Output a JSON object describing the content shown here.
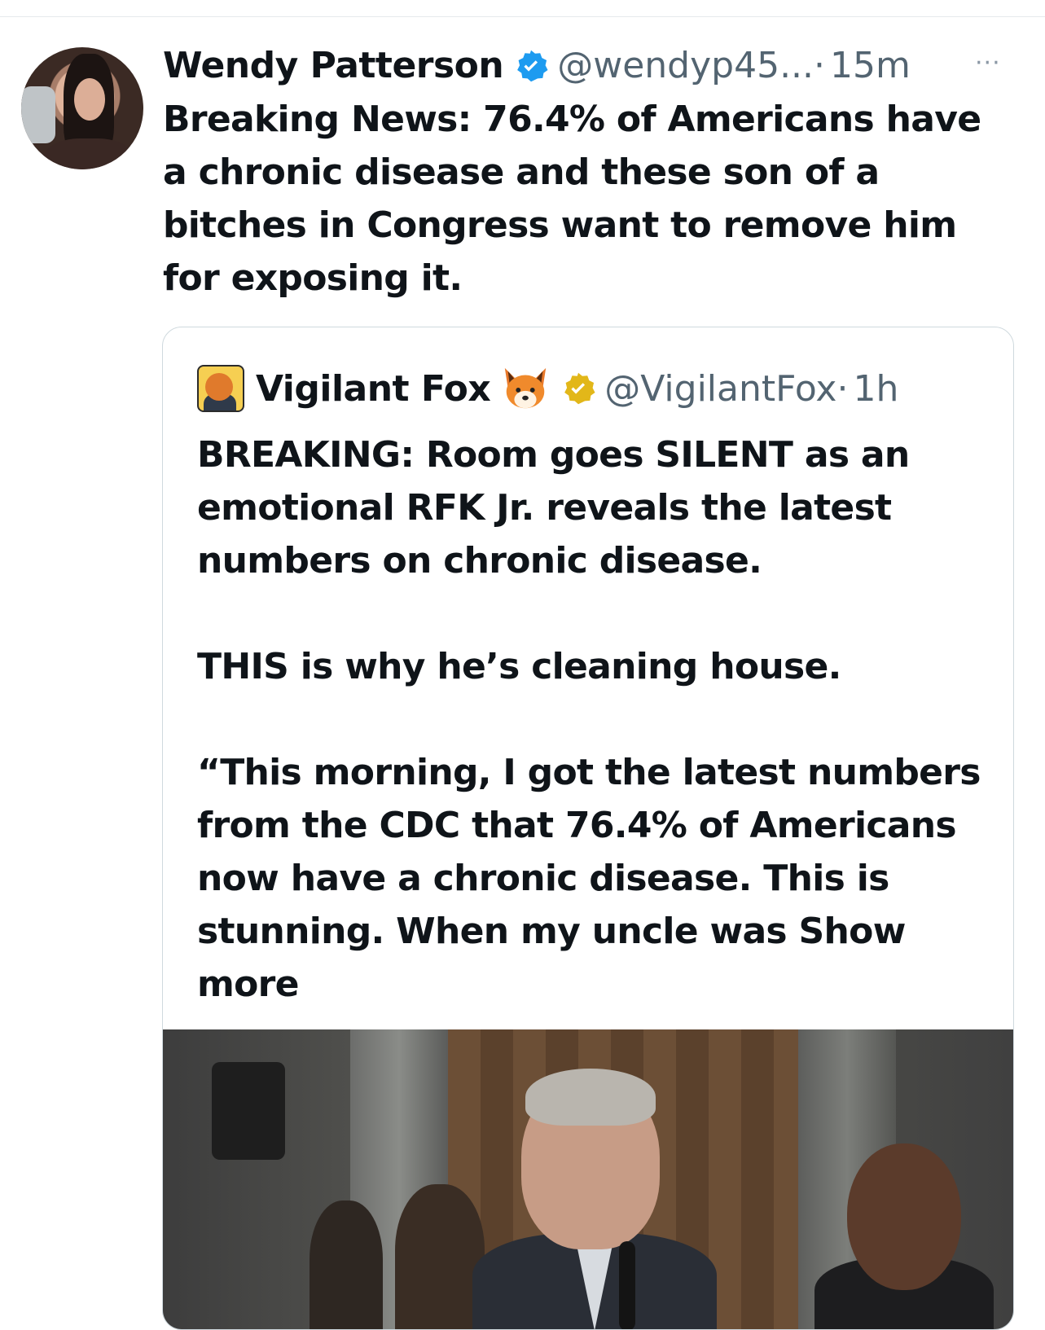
{
  "post": {
    "display_name": "Wendy Patterson",
    "handle": "@wendyp45...",
    "separator": "·",
    "time": "15m",
    "more_label": "···",
    "text": "Breaking News: 76.4% of Americans have a chronic disease and these son of a bitches in Congress want to remove him for exposing it.",
    "verified_color": "#1d9bf0"
  },
  "quote": {
    "display_name": "Vigilant Fox",
    "handle": "@VigilantFox",
    "separator": "·",
    "time": "1h",
    "text": "BREAKING: Room goes SILENT as an emotional RFK Jr. reveals the latest numbers on chronic disease.\n\nTHIS is why he’s cleaning house.\n\n“This morning, I got the latest numbers from the CDC that 76.4% of Americans now have a chronic disease. This is stunning. When my uncle was ",
    "show_more": "Show more",
    "verified_color": "#e2b719"
  }
}
